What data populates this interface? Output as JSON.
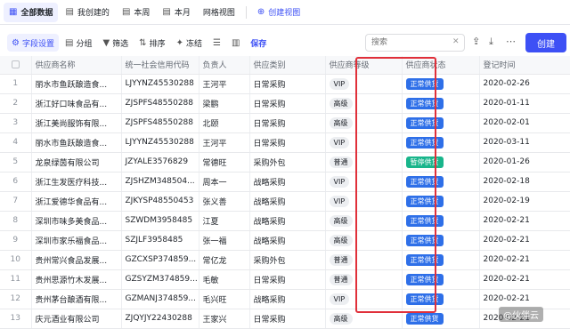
{
  "views": {
    "tabs": [
      {
        "label": "全部数据",
        "icon": "grid-icon",
        "active": true
      },
      {
        "label": "我创建的",
        "icon": "table-icon",
        "active": false
      },
      {
        "label": "本周",
        "icon": "table-icon",
        "active": false
      },
      {
        "label": "本月",
        "icon": "table-icon",
        "active": false
      },
      {
        "label": "网格视图",
        "icon": "",
        "active": false
      }
    ],
    "create_label": "创建视图"
  },
  "toolbar": {
    "field_settings": "字段设置",
    "group": "分组",
    "filter": "筛选",
    "sort": "排序",
    "freeze": "冻结",
    "save": "保存",
    "search_placeholder": "搜索",
    "create": "创建"
  },
  "table": {
    "columns": [
      "供应商名称",
      "统一社会信用代码",
      "负责人",
      "供应类别",
      "供应商等级",
      "供应商状态",
      "登记时间"
    ],
    "rows": [
      {
        "no": "1",
        "name": "丽水市鱼跃酿造食...",
        "code": "LJYYNZ45530288",
        "owner": "王河平",
        "category": "日常采购",
        "level": "VIP",
        "status": "正常供货",
        "date": "2020-02-26"
      },
      {
        "no": "2",
        "name": "浙江好口味食品有...",
        "code": "ZJSPFS48550288",
        "owner": "梁鹏",
        "category": "日常采购",
        "level": "高级",
        "status": "正常供货",
        "date": "2020-01-11"
      },
      {
        "no": "3",
        "name": "浙江美尚服饰有限...",
        "code": "ZJSPFS48550288",
        "owner": "北颐",
        "category": "日常采购",
        "level": "高级",
        "status": "正常供货",
        "date": "2020-02-01"
      },
      {
        "no": "4",
        "name": "丽水市鱼跃酿造食...",
        "code": "LJYYNZ45530288",
        "owner": "王河平",
        "category": "日常采购",
        "level": "VIP",
        "status": "正常供货",
        "date": "2020-03-11"
      },
      {
        "no": "5",
        "name": "龙泉绿茵有限公司",
        "code": "JZYALE3576829",
        "owner": "常德旺",
        "category": "采购外包",
        "level": "普通",
        "status": "暂停供货",
        "date": "2020-01-26"
      },
      {
        "no": "6",
        "name": "浙江生发医疗科技...",
        "code": "ZJSHZM348504...",
        "owner": "周本一",
        "category": "战略采购",
        "level": "VIP",
        "status": "正常供货",
        "date": "2020-02-18"
      },
      {
        "no": "7",
        "name": "浙江爱德华食品有...",
        "code": "ZJKYSP48550453",
        "owner": "张义善",
        "category": "战略采购",
        "level": "VIP",
        "status": "正常供货",
        "date": "2020-02-19"
      },
      {
        "no": "8",
        "name": "深圳市味多美食品...",
        "code": "SZWDM3958485",
        "owner": "江夏",
        "category": "战略采购",
        "level": "高级",
        "status": "正常供货",
        "date": "2020-02-21"
      },
      {
        "no": "9",
        "name": "深圳市家乐福食品...",
        "code": "SZJLF3958485",
        "owner": "张一福",
        "category": "战略采购",
        "level": "高级",
        "status": "正常供货",
        "date": "2020-02-21"
      },
      {
        "no": "10",
        "name": "贵州常兴食品发展...",
        "code": "GZCXSP374859...",
        "owner": "常亿龙",
        "category": "采购外包",
        "level": "普通",
        "status": "正常供货",
        "date": "2020-02-21"
      },
      {
        "no": "11",
        "name": "贵州思源竹木发展...",
        "code": "GZSYZM374859...",
        "owner": "毛敏",
        "category": "日常采购",
        "level": "普通",
        "status": "正常供货",
        "date": "2020-02-21"
      },
      {
        "no": "12",
        "name": "贵州茅台酿酒有限...",
        "code": "GZMANJ374859...",
        "owner": "毛兴旺",
        "category": "战略采购",
        "level": "VIP",
        "status": "正常供货",
        "date": "2020-02-21"
      },
      {
        "no": "13",
        "name": "庆元酒业有限公司",
        "code": "ZJQYJY22430288",
        "owner": "王家兴",
        "category": "日常采购",
        "level": "高级",
        "status": "正常供货",
        "date": "2020-02-21"
      }
    ]
  },
  "colors": {
    "accent": "#3d50f5",
    "status_normal": "#2e6fe8",
    "status_paused": "#18b58b",
    "highlight_border": "#e0303a"
  },
  "watermark": "@伙伴云"
}
